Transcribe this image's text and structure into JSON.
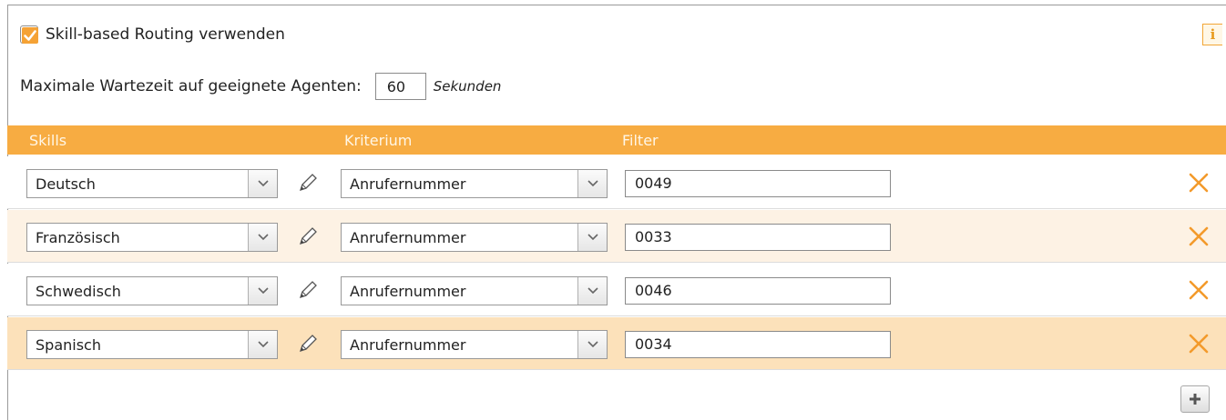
{
  "routing": {
    "checkbox_checked": true,
    "label": "Skill-based Routing verwenden",
    "info_icon": "i"
  },
  "wait": {
    "label": "Maximale Wartezeit auf geeignete Agenten:",
    "value": "60",
    "unit": "Sekunden"
  },
  "table": {
    "headers": {
      "skills": "Skills",
      "kriterium": "Kriterium",
      "filter": "Filter"
    },
    "rows": [
      {
        "skill": "Deutsch",
        "kriterium": "Anrufernummer",
        "filter": "0049"
      },
      {
        "skill": "Französisch",
        "kriterium": "Anrufernummer",
        "filter": "0033"
      },
      {
        "skill": "Schwedisch",
        "kriterium": "Anrufernummer",
        "filter": "0046"
      },
      {
        "skill": "Spanisch",
        "kriterium": "Anrufernummer",
        "filter": "0034"
      }
    ]
  },
  "colors": {
    "accent": "#f7ac42",
    "row_alt": "#fdf2e4",
    "row_selected": "#fce1ba",
    "delete": "#f39a2b"
  },
  "icons": {
    "checkbox": "checkmark-icon",
    "info": "info-icon",
    "dropdown": "chevron-down-icon",
    "edit": "pencil-icon",
    "delete": "close-icon",
    "add": "plus-icon"
  }
}
